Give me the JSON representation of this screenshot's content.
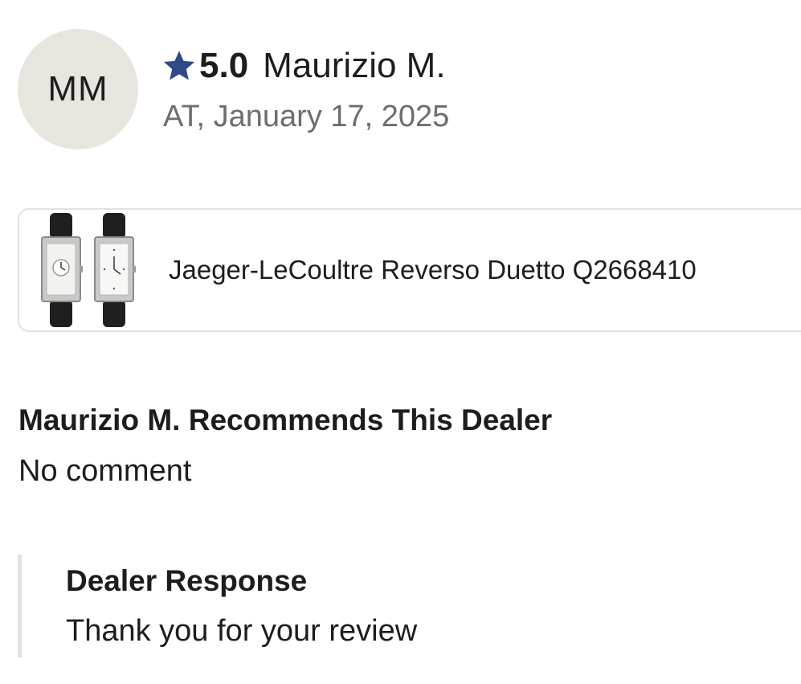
{
  "review": {
    "avatar_initials": "MM",
    "rating_icon": "star-icon",
    "rating_value": "5.0",
    "reviewer_name": "Maurizio M.",
    "meta": "AT, January 17, 2025"
  },
  "product": {
    "thumbnail_icon": "watch-thumbnail",
    "name": "Jaeger-LeCoultre Reverso Duetto Q2668410"
  },
  "recommendation": {
    "title": "Maurizio M. Recommends This Dealer",
    "comment": "No comment"
  },
  "dealer_response": {
    "title": "Dealer Response",
    "text": "Thank you for your review"
  },
  "colors": {
    "star": "#2f4a86",
    "avatar_bg": "#e8e5df",
    "border": "#e2e2e2",
    "muted_text": "#6d6d6d"
  }
}
